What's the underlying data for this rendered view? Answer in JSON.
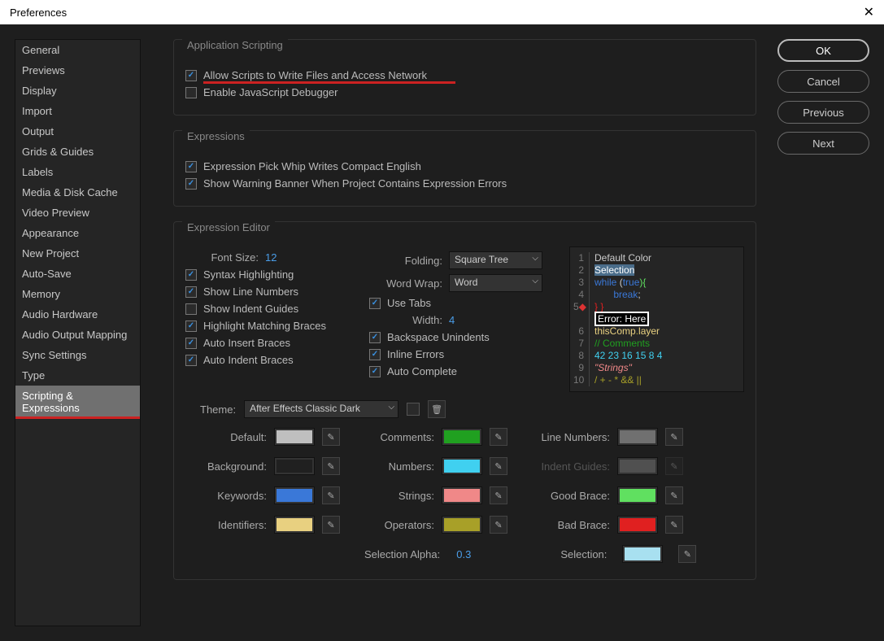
{
  "window": {
    "title": "Preferences"
  },
  "buttons": {
    "ok": "OK",
    "cancel": "Cancel",
    "previous": "Previous",
    "next": "Next"
  },
  "sidebar": {
    "items": [
      {
        "label": "General"
      },
      {
        "label": "Previews"
      },
      {
        "label": "Display"
      },
      {
        "label": "Import"
      },
      {
        "label": "Output"
      },
      {
        "label": "Grids & Guides"
      },
      {
        "label": "Labels"
      },
      {
        "label": "Media & Disk Cache"
      },
      {
        "label": "Video Preview"
      },
      {
        "label": "Appearance"
      },
      {
        "label": "New Project"
      },
      {
        "label": "Auto-Save"
      },
      {
        "label": "Memory"
      },
      {
        "label": "Audio Hardware"
      },
      {
        "label": "Audio Output Mapping"
      },
      {
        "label": "Sync Settings"
      },
      {
        "label": "Type"
      },
      {
        "label": "Scripting & Expressions"
      }
    ],
    "selectedIndex": 17
  },
  "sections": {
    "appScripting": {
      "title": "Application Scripting",
      "allowScripts": "Allow Scripts to Write Files and Access Network",
      "enableDebugger": "Enable JavaScript Debugger"
    },
    "expressions": {
      "title": "Expressions",
      "pickWhip": "Expression Pick Whip Writes Compact English",
      "warningBanner": "Show Warning Banner When Project Contains Expression Errors"
    },
    "editor": {
      "title": "Expression Editor",
      "fontSizeLabel": "Font Size:",
      "fontSizeValue": "12",
      "foldingLabel": "Folding:",
      "foldingValue": "Square Tree",
      "wordWrapLabel": "Word Wrap:",
      "wordWrapValue": "Word",
      "widthLabel": "Width:",
      "widthValue": "4",
      "checkboxes": {
        "syntax": "Syntax Highlighting",
        "lineNumbers": "Show Line Numbers",
        "indentGuides": "Show Indent Guides",
        "matchBraces": "Highlight Matching Braces",
        "autoInsert": "Auto Insert Braces",
        "autoIndent": "Auto Indent Braces",
        "useTabs": "Use Tabs",
        "backspace": "Backspace Unindents",
        "inlineErrors": "Inline Errors",
        "autoComplete": "Auto Complete"
      },
      "code": {
        "l1": "Default Color",
        "l2": "Selection",
        "l3a": "while",
        "l3b": " (",
        "l3c": "true",
        "l3d": "){",
        "l4": "       break",
        "l5": "} }",
        "l6": "Error: Here",
        "l7a": "thisComp",
        "l7b": ".",
        "l7c": "layer",
        "l8": "// Comments",
        "l9": "42 23 16 15 8 4",
        "l10": "\"Strings\"",
        "l11": "/ + - * && ||"
      },
      "themeLabel": "Theme:",
      "themeValue": "After Effects Classic Dark",
      "colors": {
        "default_l": "Default:",
        "default_c": "#bfbfbf",
        "comments_l": "Comments:",
        "comments_c": "#20a020",
        "linenum_l": "Line Numbers:",
        "linenum_c": "#707070",
        "background_l": "Background:",
        "background_c": "#202020",
        "numbers_l": "Numbers:",
        "numbers_c": "#40d0f0",
        "indent_l": "Indent Guides:",
        "indent_c": "#505050",
        "keywords_l": "Keywords:",
        "keywords_c": "#3a78d8",
        "strings_l": "Strings:",
        "strings_c": "#f08888",
        "goodbrace_l": "Good Brace:",
        "goodbrace_c": "#60e060",
        "identifiers_l": "Identifiers:",
        "identifiers_c": "#e8d080",
        "operators_l": "Operators:",
        "operators_c": "#a8a028",
        "badbrace_l": "Bad Brace:",
        "badbrace_c": "#e02020",
        "selalpha_l": "Selection Alpha:",
        "selalpha_v": "0.3",
        "selection_l": "Selection:",
        "selection_c": "#a8e0f0"
      }
    }
  }
}
